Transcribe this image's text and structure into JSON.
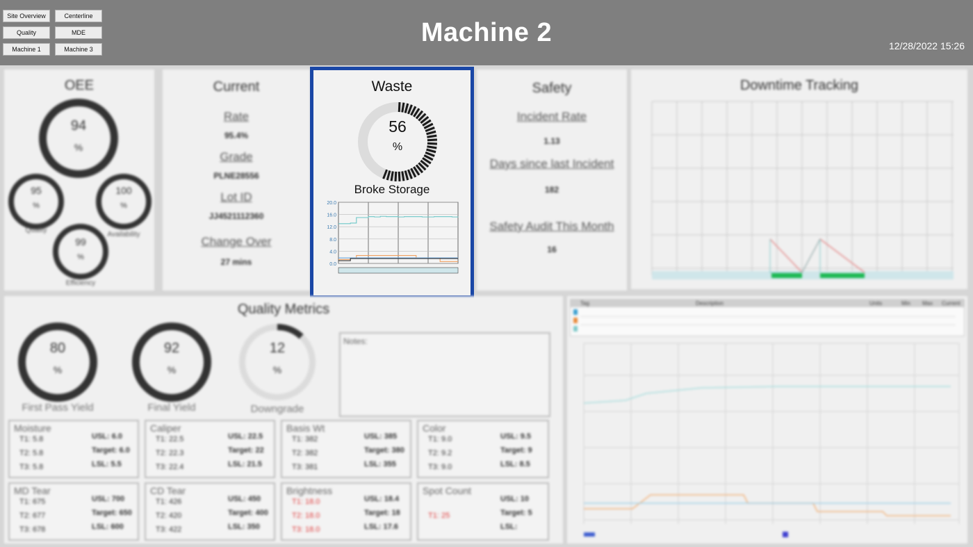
{
  "header": {
    "nav": [
      "Site Overview",
      "Centerline",
      "Quality",
      "MDE",
      "Machine 1",
      "Machine 3"
    ],
    "title": "Machine 2",
    "datetime": "12/28/2022 15:26"
  },
  "oee": {
    "title": "OEE",
    "main_value": "94",
    "unit": "%",
    "quality_value": "95",
    "quality_label": "Quality",
    "availability_value": "100",
    "availability_label": "Availability",
    "efficiency_value": "99",
    "efficiency_label": "Efficiency"
  },
  "current": {
    "title": "Current",
    "rate_label": "Rate",
    "rate_value": "95.4%",
    "grade_label": "Grade",
    "grade_value": "PLNE28556",
    "lot_label": "Lot ID",
    "lot_value": "JJ4521112360",
    "changeover_label": "Change Over",
    "changeover_value": "27 mins"
  },
  "waste": {
    "title": "Waste",
    "value": "56",
    "percent": 56,
    "unit": "%",
    "subtitle": "Broke Storage",
    "colors": {
      "accent": "#1a47a6",
      "ring_fill": "#1a1a1a",
      "ring_track": "#dcdcdc"
    }
  },
  "chart_data": {
    "type": "line",
    "ylim": [
      0,
      20
    ],
    "yticks": [
      "20.0",
      "16.0",
      "12.0",
      "8.0",
      "4.0",
      "0.0"
    ],
    "x": [
      0,
      1,
      2,
      3,
      4,
      5,
      6,
      7,
      8,
      9,
      10,
      11,
      12,
      13,
      14,
      15,
      16,
      17,
      18,
      19,
      20
    ],
    "series": [
      {
        "color": "#6cc7c7",
        "values": [
          13,
          13,
          13.2,
          15,
          15,
          15.3,
          15.2,
          15.4,
          15.3,
          15.3,
          15.2,
          15.3,
          15.3,
          15.3,
          15.2,
          15.2,
          15.3,
          15.3,
          15.3,
          15.2,
          15.3
        ]
      },
      {
        "color": "#f0a060",
        "values": [
          1.3,
          1.3,
          1.6,
          2.6,
          2.6,
          2.6,
          2.6,
          2.6,
          2.6,
          2.6,
          2.6,
          2.6,
          2.6,
          1.7,
          1.7,
          1.7,
          1.7,
          0.6,
          0.6,
          0.6,
          0.6
        ]
      },
      {
        "color": "#6aa9e0",
        "values": [
          1.8,
          1.8,
          1.8,
          1.8,
          1.8,
          1.8,
          1.8,
          1.8,
          1.8,
          1.8,
          1.8,
          1.8,
          1.8,
          1.8,
          1.8,
          1.8,
          1.8,
          1.8,
          1.8,
          1.8,
          1.8
        ]
      },
      {
        "color": "#333333",
        "values": [
          0.9,
          0.9,
          1.6,
          1.6,
          1.6,
          1.6,
          1.6,
          1.6,
          1.6,
          1.6,
          1.6,
          1.6,
          1.6,
          1.6,
          1.6,
          1.6,
          1.6,
          1.6,
          1.6,
          1.6,
          1.6
        ]
      }
    ]
  },
  "safety": {
    "title": "Safety",
    "incident_label": "Incident Rate",
    "incident_value": "1.13",
    "days_label": "Days since last Incident",
    "days_value": "182",
    "audit_label": "Safety Audit This Month",
    "audit_value": "16"
  },
  "downtime": {
    "title": "Downtime Tracking"
  },
  "quality_metrics": {
    "title": "Quality Metrics",
    "fpy_value": "80",
    "fpy_label": "First Pass Yield",
    "fy_value": "92",
    "fy_label": "Final Yield",
    "dg_value": "12",
    "dg_label": "Downgrade",
    "unit": "%",
    "notes_label": "Notes:"
  },
  "metrics": [
    {
      "title": "Moisture",
      "t": [
        "T1: 5.8",
        "T2: 5.8",
        "T3: 5.8"
      ],
      "r": [
        "USL: 6.0",
        "Target: 6.0",
        "LSL: 5.5"
      ]
    },
    {
      "title": "Caliper",
      "t": [
        "T1: 22.5",
        "T2: 22.3",
        "T3: 22.4"
      ],
      "r": [
        "USL: 22.5",
        "Target: 22",
        "LSL: 21.5"
      ]
    },
    {
      "title": "Basis Wt",
      "t": [
        "T1: 382",
        "T2: 382",
        "T3: 381"
      ],
      "r": [
        "USL: 385",
        "Target: 380",
        "LSL: 355"
      ]
    },
    {
      "title": "Color",
      "t": [
        "T1: 9.0",
        "T2: 9.2",
        "T3: 9.0"
      ],
      "r": [
        "USL: 9.5",
        "Target: 9",
        "LSL: 8.5"
      ]
    },
    {
      "title": "MD Tear",
      "t": [
        "T1: 675",
        "T2: 677",
        "T3: 678"
      ],
      "r": [
        "USL: 700",
        "Target: 650",
        "LSL: 600"
      ]
    },
    {
      "title": "CD Tear",
      "t": [
        "T1: 426",
        "T2: 420",
        "T3: 422"
      ],
      "r": [
        "USL: 450",
        "Target: 400",
        "LSL: 350"
      ]
    },
    {
      "title": "Brightness",
      "t": [
        "T1: 18.0",
        "T2: 18.0",
        "T3: 18.0"
      ],
      "r": [
        "USL: 18.4",
        "Target: 18",
        "LSL: 17.6"
      ]
    },
    {
      "title": "Spot Count",
      "t": [
        "",
        "T1: 25",
        ""
      ],
      "r": [
        "USL: 10",
        "Target: 5",
        "LSL:"
      ]
    }
  ],
  "trend_table": {
    "headers": [
      "Tag",
      "Description",
      "Units",
      "Min",
      "Max",
      "Current"
    ]
  }
}
